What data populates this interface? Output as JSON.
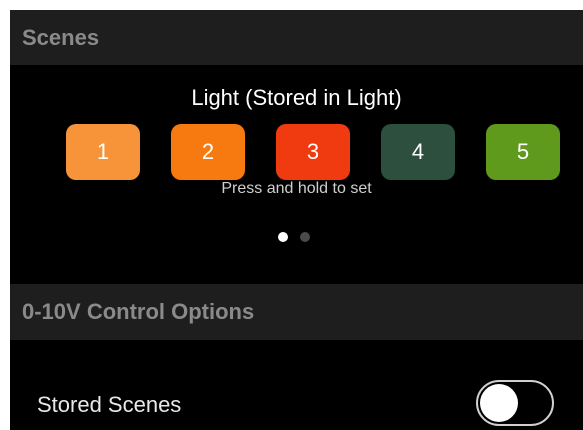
{
  "sections": {
    "scenes_header": "Scenes",
    "control_header": "0-10V Control Options"
  },
  "scenes": {
    "title": "Light (Stored in Light)",
    "hint": "Press and hold to set",
    "buttons": [
      {
        "label": "1",
        "color": "#f7943a"
      },
      {
        "label": "2",
        "color": "#f77a10"
      },
      {
        "label": "3",
        "color": "#f03a10"
      },
      {
        "label": "4",
        "color": "#2d4f3d"
      },
      {
        "label": "5",
        "color": "#5f9a1c"
      }
    ],
    "page_indicator": {
      "pages": 2,
      "current": 1,
      "active_color": "#ffffff",
      "inactive_color": "#4a4a4a"
    }
  },
  "control_options": {
    "stored_scenes_label": "Stored Scenes",
    "stored_scenes_enabled": false
  }
}
